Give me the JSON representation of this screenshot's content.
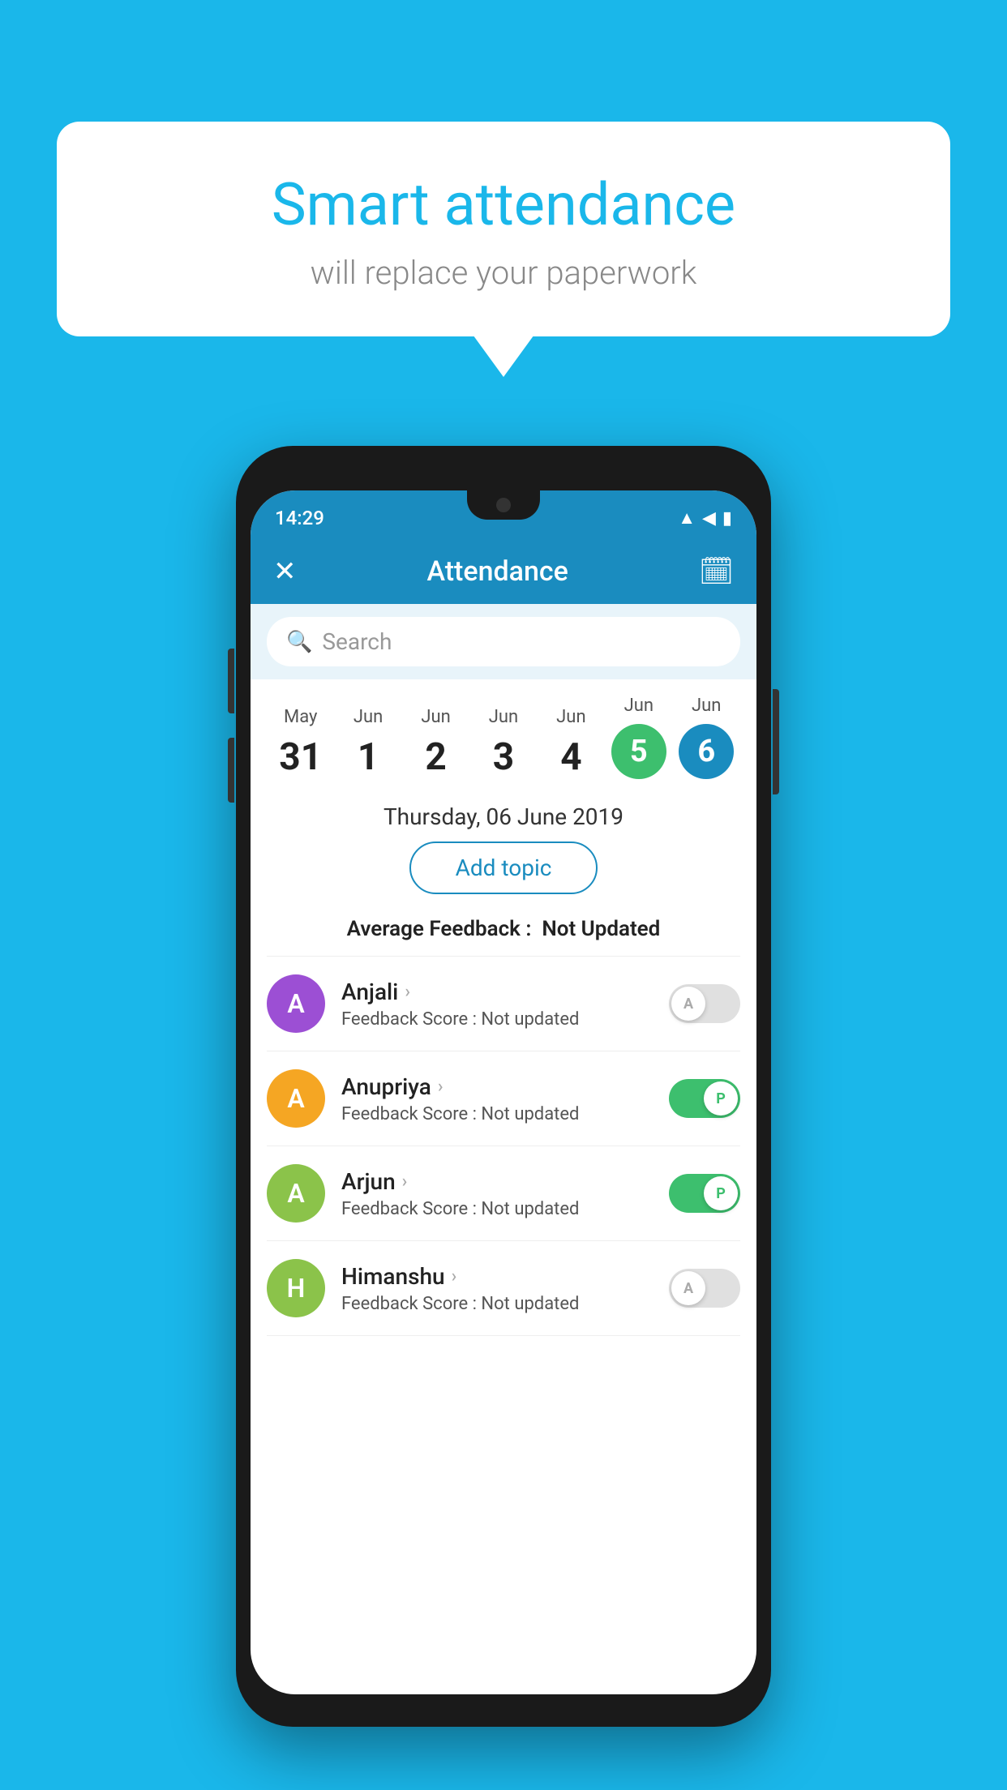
{
  "background_color": "#1ab7ea",
  "bubble": {
    "title": "Smart attendance",
    "subtitle": "will replace your paperwork"
  },
  "status_bar": {
    "time": "14:29",
    "wifi": "▲",
    "signal": "◀",
    "battery": "▮"
  },
  "app_bar": {
    "title": "Attendance",
    "close_icon": "✕",
    "calendar_icon": "📅"
  },
  "search": {
    "placeholder": "Search"
  },
  "calendar": {
    "days": [
      {
        "month": "May",
        "date": "31",
        "state": "normal"
      },
      {
        "month": "Jun",
        "date": "1",
        "state": "normal"
      },
      {
        "month": "Jun",
        "date": "2",
        "state": "normal"
      },
      {
        "month": "Jun",
        "date": "3",
        "state": "normal"
      },
      {
        "month": "Jun",
        "date": "4",
        "state": "normal"
      },
      {
        "month": "Jun",
        "date": "5",
        "state": "green"
      },
      {
        "month": "Jun",
        "date": "6",
        "state": "blue"
      }
    ]
  },
  "selected_date": "Thursday, 06 June 2019",
  "add_topic_label": "Add topic",
  "avg_feedback_label": "Average Feedback :",
  "avg_feedback_value": "Not Updated",
  "students": [
    {
      "name": "Anjali",
      "avatar_letter": "A",
      "avatar_color": "#9c4fd4",
      "feedback_label": "Feedback Score :",
      "feedback_value": "Not updated",
      "toggle_state": "off",
      "toggle_label": "A"
    },
    {
      "name": "Anupriya",
      "avatar_letter": "A",
      "avatar_color": "#f5a623",
      "feedback_label": "Feedback Score :",
      "feedback_value": "Not updated",
      "toggle_state": "on",
      "toggle_label": "P"
    },
    {
      "name": "Arjun",
      "avatar_letter": "A",
      "avatar_color": "#8bc34a",
      "feedback_label": "Feedback Score :",
      "feedback_value": "Not updated",
      "toggle_state": "on",
      "toggle_label": "P"
    },
    {
      "name": "Himanshu",
      "avatar_letter": "H",
      "avatar_color": "#8bc34a",
      "feedback_label": "Feedback Score :",
      "feedback_value": "Not updated",
      "toggle_state": "off",
      "toggle_label": "A"
    }
  ]
}
